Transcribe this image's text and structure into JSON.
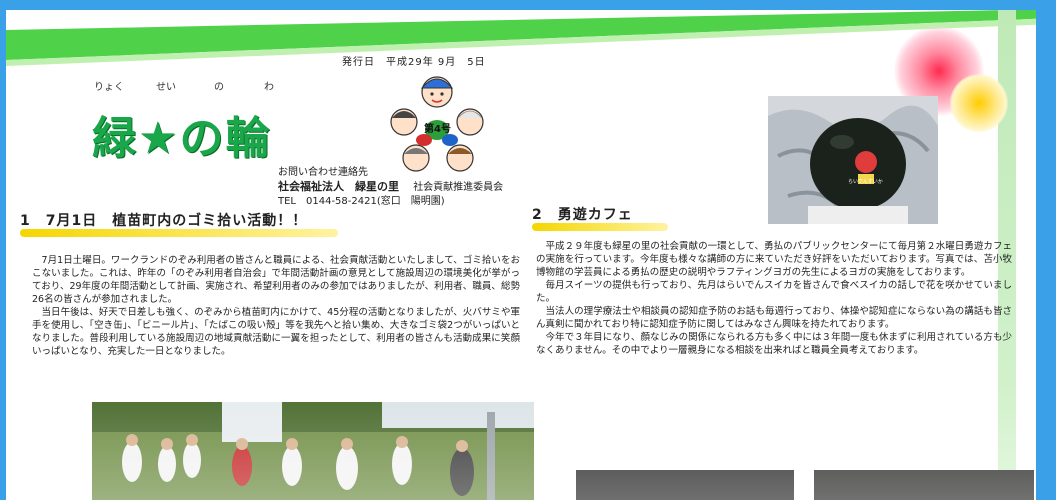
{
  "header": {
    "issue_date": "発行日　平成29年 9月　5日",
    "ruby": [
      "りょく",
      "せい",
      "の",
      "わ"
    ],
    "title": "緑★の輪",
    "issue_number": "第4号",
    "contact_label": "お問い合わせ連絡先",
    "org": "社会福祉法人　緑星の里　",
    "committee": "社会貢献推進委員会",
    "tel": "TEL　0144-58-2421(窓口　陽明園)"
  },
  "section1": {
    "title": "1　7月1日　植苗町内のゴミ拾い活動！！",
    "paragraphs": [
      "7月1日土曜日。ワークランドのぞみ利用者の皆さんと職員による、社会貢献活動といたしまして、ゴミ拾いをおこないました。これは、昨年の「のぞみ利用者自治会」で年間活動計画の意見として施設周辺の環境美化が挙がっており、29年度の年間活動として計画、実施され、希望利用者のみの参加ではありましたが、利用者、職員、総勢26名の皆さんが参加されました。",
      "当日午後は、好天で日差しも強く、のぞみから植苗町内にかけて、45分程の活動となりましたが、火バサミや軍手を使用し、「空き缶」、「ビニール片」、「たばこの吸い殻」等を我先へと拾い集め、大きなゴミ袋2つがいっぱいとなりました。普段利用している施設周辺の地域貢献活動に一翼を担ったとして、利用者の皆さんも活動成果に笑顔いっぱいとなり、充実した一日となりました。"
    ]
  },
  "section2": {
    "title": "2　勇遊カフェ",
    "paragraphs": [
      "平成２９年度も緑星の里の社会貢献の一環として、勇払のパブリックセンターにて毎月第２水曜日勇遊カフェの実施を行っています。今年度も様々な講師の方に来ていただき好評をいただいております。写真では、苫小牧博物館の学芸員による勇払の歴史の説明やラフティングヨガの先生によるヨガの実施をしております。",
      "毎月スイーツの提供も行っており、先月はらいでんスイカを皆さんで食べスイカの話しで花を咲かせていました。",
      "当法人の理学療法士や相談員の認知症予防のお話も毎週行っており、体操や認知症にならない為の講話も皆さん真剣に聞かれており特に認知症予防に関してはみなさん興味を持たれております。",
      "今年で３年目になり、顔なじみの関係になられる方も多く中には３年間一度も休まずに利用されている方も少なくありません。その中でより一層親身になる相談を出来ればと職員全員考えております。"
    ]
  },
  "photos": {
    "watermelon_label": "らいでんすいか"
  },
  "colors": {
    "title_green": "#1aa74a",
    "band_green": "#4fd24a",
    "accent_yellow": "#f5d600",
    "frame_blue": "#3aa0e8"
  }
}
